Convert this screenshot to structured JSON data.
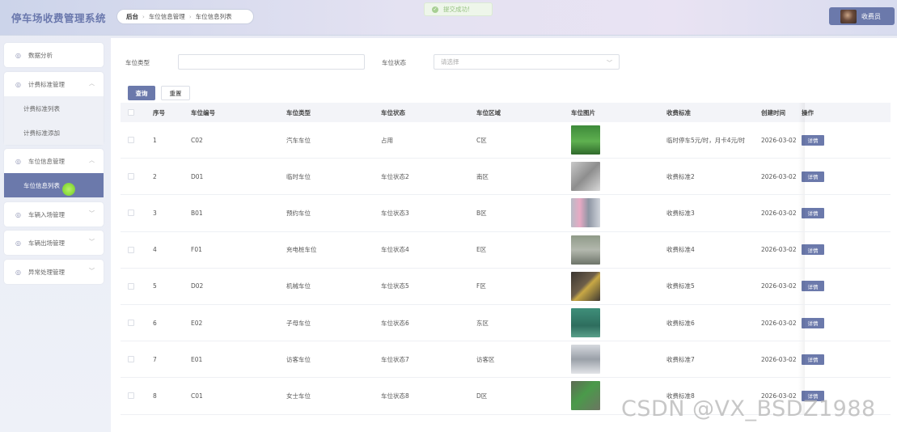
{
  "header": {
    "app_title": "停车场收费管理系统",
    "breadcrumb": [
      "后台",
      "车位信息管理",
      "车位信息列表"
    ],
    "toast": "提交成功!",
    "user_label": "收费员"
  },
  "sidebar": {
    "menus": [
      {
        "label": "数据分析",
        "expanded": false,
        "has_chevron": false
      },
      {
        "label": "计费标准管理",
        "expanded": true,
        "has_chevron": true,
        "children": [
          "计费标准列表",
          "计费标准添加"
        ]
      },
      {
        "label": "车位信息管理",
        "expanded": true,
        "has_chevron": true,
        "children": [
          "车位信息列表"
        ],
        "active_child": "车位信息列表"
      },
      {
        "label": "车辆入场管理",
        "expanded": false,
        "has_chevron": true
      },
      {
        "label": "车辆出场管理",
        "expanded": false,
        "has_chevron": true
      },
      {
        "label": "异常处理管理",
        "expanded": false,
        "has_chevron": true
      }
    ]
  },
  "filters": {
    "type_label": "车位类型",
    "type_value": "",
    "status_label": "车位状态",
    "status_placeholder": "请选择",
    "search_button": "查询",
    "reset_button": "重置"
  },
  "table": {
    "columns": [
      "序号",
      "车位编号",
      "车位类型",
      "车位状态",
      "车位区域",
      "车位图片",
      "收费标准",
      "创建时间",
      "操作"
    ],
    "detail_label": "详情",
    "rows": [
      {
        "no": "1",
        "code": "C02",
        "type": "汽车车位",
        "status": "占用",
        "area": "C区",
        "standard": "临时停车5元/时，月卡4元/时",
        "created": "2026-03-02",
        "img": "green-lot"
      },
      {
        "no": "2",
        "code": "D01",
        "type": "临时车位",
        "status": "车位状态2",
        "area": "南区",
        "standard": "收费标准2",
        "created": "2026-03-02",
        "img": "gray-lot"
      },
      {
        "no": "3",
        "code": "B01",
        "type": "预约车位",
        "status": "车位状态3",
        "area": "B区",
        "standard": "收费标准3",
        "created": "2026-03-02",
        "img": "indoor-lot"
      },
      {
        "no": "4",
        "code": "F01",
        "type": "充电桩车位",
        "status": "车位状态4",
        "area": "E区",
        "standard": "收费标准4",
        "created": "2026-03-02",
        "img": "outdoor-lot"
      },
      {
        "no": "5",
        "code": "D02",
        "type": "机械车位",
        "status": "车位状态5",
        "area": "F区",
        "standard": "收费标准5",
        "created": "2026-03-02",
        "img": "dark-lot"
      },
      {
        "no": "6",
        "code": "E02",
        "type": "子母车位",
        "status": "车位状态6",
        "area": "东区",
        "standard": "收费标准6",
        "created": "2026-03-02",
        "img": "teal-lot"
      },
      {
        "no": "7",
        "code": "E01",
        "type": "访客车位",
        "status": "车位状态7",
        "area": "访客区",
        "standard": "收费标准7",
        "created": "2026-03-02",
        "img": "car-lot"
      },
      {
        "no": "8",
        "code": "C01",
        "type": "女士车位",
        "status": "车位状态8",
        "area": "D区",
        "standard": "收费标准8",
        "created": "2026-03-02",
        "img": "green-line-lot"
      }
    ]
  },
  "watermark": "CSDN @VX_BSDZ1988",
  "colors": {
    "accent": "#6b79ab",
    "toast_text": "#97c282"
  }
}
